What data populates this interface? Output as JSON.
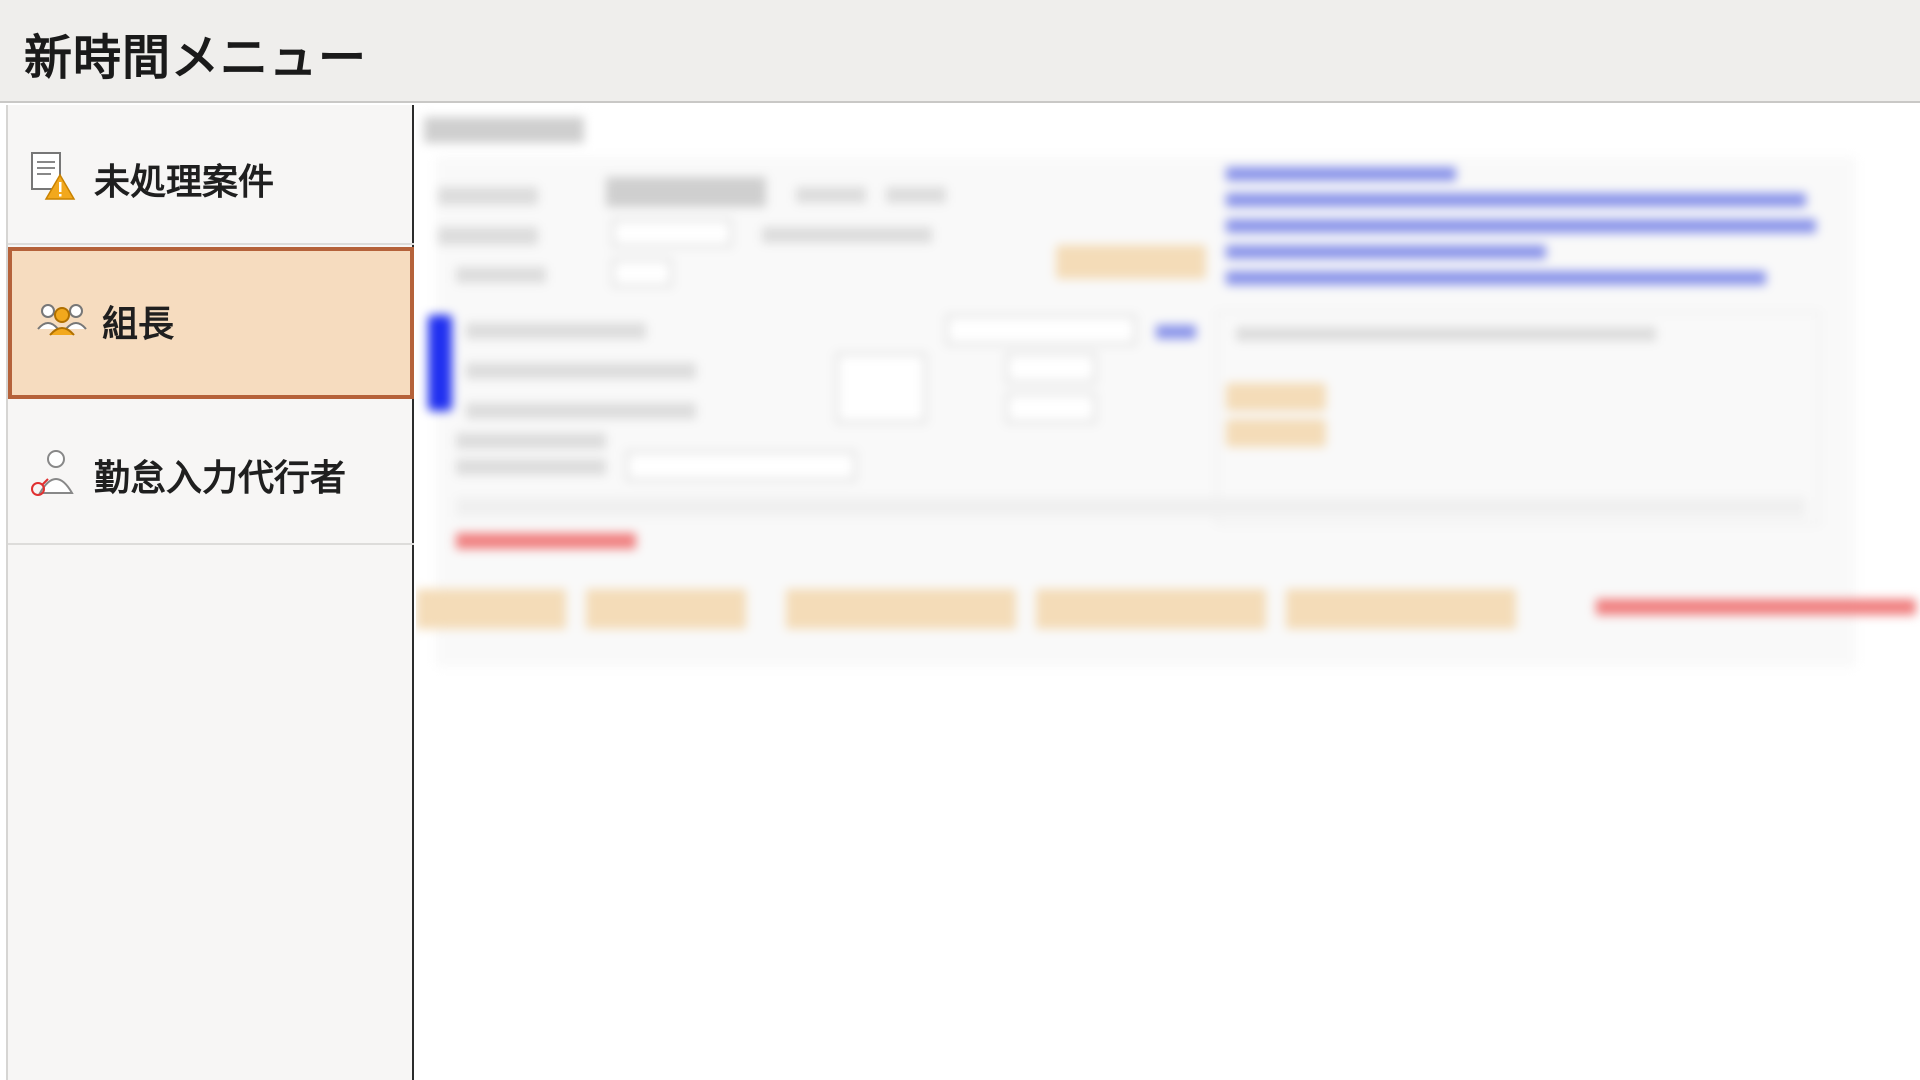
{
  "header": {
    "title": "新時間メニュー"
  },
  "sidebar": {
    "items": [
      {
        "label": "未処理案件",
        "icon": "document-warning-icon",
        "active": false
      },
      {
        "label": "組長",
        "icon": "group-people-icon",
        "active": true
      },
      {
        "label": "勤怠入力代行者",
        "icon": "user-proxy-icon",
        "active": false
      }
    ]
  },
  "colors": {
    "header_bg": "#efeeec",
    "sidebar_bg": "#f7f6f5",
    "active_bg": "#f6dcbf",
    "active_border": "#b5623a",
    "link": "#2435d8",
    "alert": "#e03030",
    "button_bg": "#f4dcb8"
  }
}
